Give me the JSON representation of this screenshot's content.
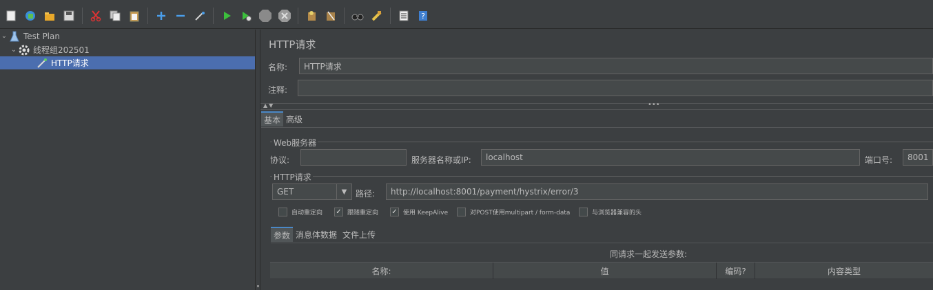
{
  "toolbar": {
    "icons": [
      "new-icon",
      "templates-icon",
      "open-icon",
      "save-icon",
      "cut-icon",
      "copy-icon",
      "paste-icon",
      "expand-icon",
      "collapse-icon",
      "toggle-icon",
      "start-icon",
      "start-no-pause-icon",
      "stop-icon",
      "shutdown-icon",
      "clear-icon",
      "clear-all-icon",
      "search-icon",
      "reset-search-icon",
      "function-helper-icon",
      "help-icon"
    ]
  },
  "tree": {
    "items": [
      {
        "label": "Test Plan",
        "icon": "test-plan-icon"
      },
      {
        "label": "线程组202501",
        "icon": "thread-group-icon"
      },
      {
        "label": "HTTP请求",
        "icon": "sampler-icon"
      }
    ]
  },
  "panel": {
    "title": "HTTP请求",
    "name_label": "名称:",
    "name_value": "HTTP请求",
    "comment_label": "注释:",
    "comment_value": ""
  },
  "tabs": {
    "main": [
      "基本",
      "高级"
    ]
  },
  "web_server": {
    "group_title": "Web服务器",
    "protocol_label": "协议:",
    "protocol_value": "",
    "server_label": "服务器名称或IP:",
    "server_value": "localhost",
    "port_label": "端口号:",
    "port_value": "8001"
  },
  "http_request": {
    "group_title": "HTTP请求",
    "method": "GET",
    "path_label": "路径:",
    "path_value": "http://localhost:8001/payment/hystrix/error/3",
    "checkboxes": [
      {
        "label": "自动重定向",
        "checked": false
      },
      {
        "label": "跟随重定向",
        "checked": true
      },
      {
        "label": "使用 KeepAlive",
        "checked": true
      },
      {
        "label": "对POST使用multipart / form-data",
        "checked": false
      },
      {
        "label": "与浏览器兼容的头",
        "checked": false
      }
    ]
  },
  "sub_tabs": [
    "参数",
    "消息体数据",
    "文件上传"
  ],
  "params_table": {
    "title": "同请求一起发送参数:",
    "columns": [
      "名称:",
      "值",
      "编码?",
      "内容类型"
    ]
  },
  "colors": {
    "background": "#3c3f41",
    "selection": "#4b6eaf",
    "field": "#45494a",
    "text": "#bbbbbb"
  }
}
